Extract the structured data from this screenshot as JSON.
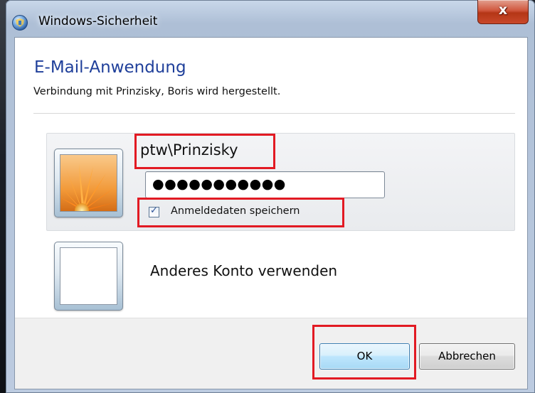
{
  "window": {
    "title": "Windows-Sicherheit",
    "close_label": "x"
  },
  "dialog": {
    "heading": "E-Mail-Anwendung",
    "subheading": "Verbindung mit Prinzisky, Boris wird hergestellt."
  },
  "credential_tile": {
    "username": "ptw\\Prinzisky",
    "password_masked": "●●●●●●●●●●●",
    "remember_label": "Anmeldedaten speichern",
    "remember_checked": true
  },
  "other_account": {
    "label": "Anderes Konto verwenden"
  },
  "buttons": {
    "ok_label": "OK",
    "cancel_label": "Abbrechen"
  },
  "colors": {
    "highlight": "#e21a23",
    "heading": "#1f3f9a"
  },
  "icons": {
    "title": "windows-security-shield-icon",
    "user_avatar": "flower-avatar-icon",
    "other_avatar": "blank-avatar-icon"
  }
}
